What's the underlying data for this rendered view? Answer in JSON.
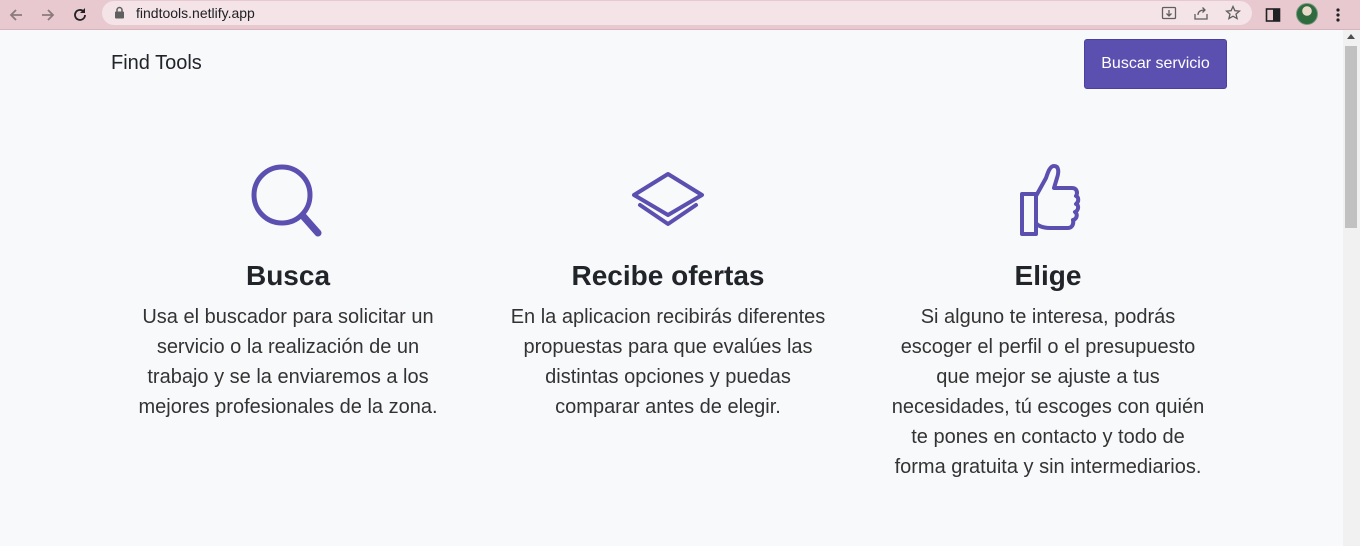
{
  "browser": {
    "url": "findtools.netlify.app"
  },
  "header": {
    "brand": "Find Tools",
    "cta_label": "Buscar servicio"
  },
  "features": [
    {
      "icon": "search-icon",
      "title": "Busca",
      "text": "Usa el buscador para solicitar un servicio o la realización de un trabajo y se la enviaremos a los mejores profesionales de la zona."
    },
    {
      "icon": "layers-icon",
      "title": "Recibe ofertas",
      "text": "En la aplicacion recibirás diferentes propuestas para que evalúes las distintas opciones y puedas comparar antes de elegir."
    },
    {
      "icon": "thumbs-up-icon",
      "title": "Elige",
      "text": "Si alguno te interesa, podrás escoger el perfil o el presupuesto que mejor se ajuste a tus necesidades, tú escoges con quién te pones en contacto y todo de forma gratuita y sin intermediarios."
    }
  ],
  "colors": {
    "accent": "#5b4fb0",
    "chrome": "#e8c9d0",
    "page_background": "#f8f9fb"
  }
}
